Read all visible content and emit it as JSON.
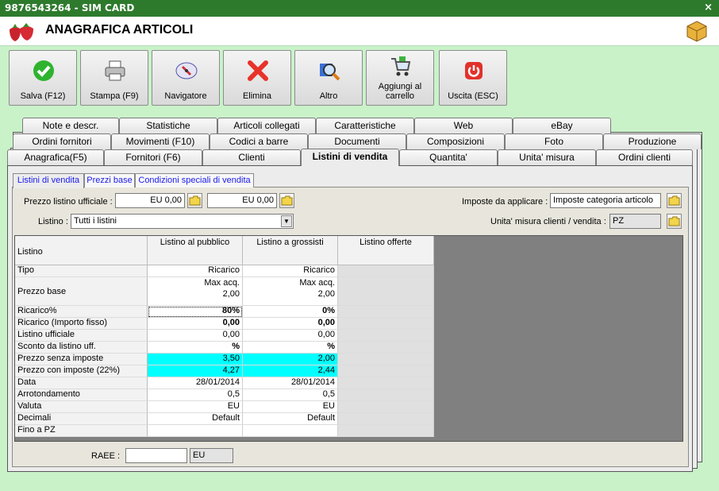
{
  "window": {
    "title": "9876543264 - SIM CARD",
    "close": "×"
  },
  "header": {
    "title": "ANAGRAFICA ARTICOLI"
  },
  "toolbar": {
    "save": "Salva (F12)",
    "print": "Stampa (F9)",
    "navigator": "Navigatore",
    "delete": "Elimina",
    "other": "Altro",
    "cart_line1": "Aggiungi al",
    "cart_line2": "carrello",
    "exit": "Uscita (ESC)"
  },
  "tabs_row1": [
    "Note e descr.",
    "Statistiche",
    "Articoli collegati",
    "Caratteristiche",
    "Web",
    "eBay"
  ],
  "tabs_row2": [
    "Ordini fornitori",
    "Movimenti (F10)",
    "Codici a barre",
    "Documenti",
    "Composizioni",
    "Foto",
    "Produzione"
  ],
  "tabs_row3": [
    "Anagrafica(F5)",
    "Fornitori (F6)",
    "Clienti",
    "Listini di vendita",
    "Quantita'",
    "Unita' misura",
    "Ordini clienti"
  ],
  "subtabs": [
    "Listini di vendita",
    "Prezzi base",
    "Condizioni speciali di vendita"
  ],
  "form": {
    "official_price_label": "Prezzo listino ufficiale :",
    "official_price_1": "EU 0,00",
    "official_price_2": "EU 0,00",
    "listino_label": "Listino :",
    "listino_value": "Tutti i listini",
    "tax_label": "Imposte da applicare :",
    "tax_value": "Imposte categoria articolo",
    "unit_label": "Unita' misura clienti / vendita :",
    "unit_value": "PZ",
    "raee_label": "RAEE :",
    "raee_value": "",
    "raee_currency": "EU"
  },
  "grid": {
    "headers": [
      "Listino",
      "Listino al pubblico",
      "Listino a grossisti",
      "Listino offerte"
    ],
    "rows": [
      {
        "label": "Tipo",
        "pub": "Ricarico",
        "gro": "Ricarico"
      },
      {
        "label": "Prezzo base",
        "pub": "Max acq.",
        "pub2": "2,00",
        "gro": "Max acq.",
        "gro2": "2,00"
      },
      {
        "label": "Ricarico%",
        "pub": "80%",
        "gro": "0%"
      },
      {
        "label": "Ricarico (Importo fisso)",
        "pub": "0,00",
        "gro": "0,00"
      },
      {
        "label": "Listino ufficiale",
        "pub": "0,00",
        "gro": "0,00"
      },
      {
        "label": "Sconto da listino uff.",
        "pub": "%",
        "gro": "%"
      },
      {
        "label": "Prezzo senza imposte",
        "pub": "3,50",
        "gro": "2,00"
      },
      {
        "label": "Prezzo con imposte (22%)",
        "pub": "4,27",
        "gro": "2,44"
      },
      {
        "label": "Data",
        "pub": "28/01/2014",
        "gro": "28/01/2014"
      },
      {
        "label": "Arrotondamento",
        "pub": "0,5",
        "gro": "0,5"
      },
      {
        "label": "Valuta",
        "pub": "EU",
        "gro": "EU"
      },
      {
        "label": "Decimali",
        "pub": "Default",
        "gro": "Default"
      },
      {
        "label": "Fino a PZ",
        "pub": "",
        "gro": ""
      }
    ]
  },
  "colors": {
    "highlight": "#00ffff",
    "background": "#c9f2c9",
    "titlebar": "#2d7a2d"
  }
}
